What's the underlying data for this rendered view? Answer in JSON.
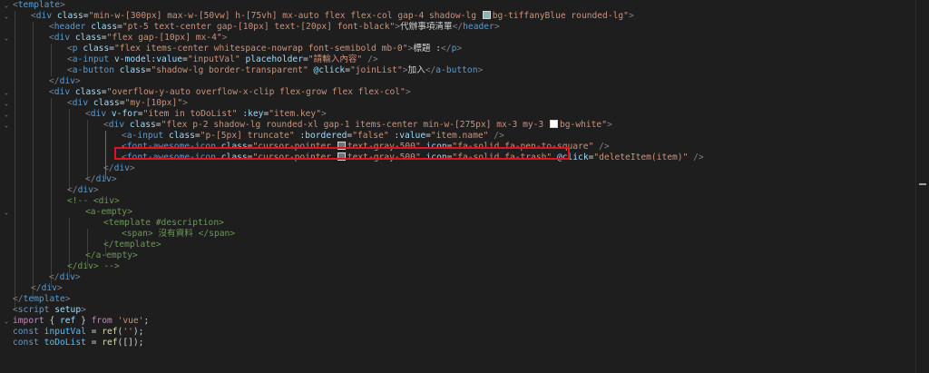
{
  "colors": {
    "background": "#1e1e1e",
    "tag": "#569cd6",
    "attribute": "#9cdcfe",
    "string": "#ce9178",
    "comment": "#6a9955",
    "keyword": "#c586c0",
    "highlight_box": "#e0141e",
    "swatch_tiffany_blue": "#7dbab5",
    "swatch_white": "#ffffff",
    "swatch_gray_500": "#6b7280"
  },
  "code": {
    "l1_tag": "template",
    "l2_tag": "div",
    "l2_attr": "class",
    "l2_val_a": "min-w-[300px] max-w-[50vw] h-[75vh] mx-auto flex flex-col gap-4 shadow-lg ",
    "l2_val_b": "bg-tiffanyBlue rounded-lg",
    "l3_tag": "header",
    "l3_attr": "class",
    "l3_val": "pt-5 text-center gap-[10px] text-[20px] font-black",
    "l3_text": "代辦事項清單",
    "l4_tag": "div",
    "l4_attr": "class",
    "l4_val": "flex gap-[10px] mx-4",
    "l5_tag": "p",
    "l5_attr": "class",
    "l5_val": "flex items-center whitespace-nowrap font-semibold mb-0",
    "l5_text": "標題 :",
    "l6_tag": "a-input",
    "l6_attr1": "v-model:value",
    "l6_val1": "inputVal",
    "l6_attr2": "placeholder",
    "l6_val2": "請輸入內容",
    "l7_tag": "a-button",
    "l7_attr1": "class",
    "l7_val1": "shadow-lg border-transparent",
    "l7_attr2": "@click",
    "l7_val2": "joinList",
    "l7_text": "加入",
    "l8_tag": "div",
    "l9_tag": "div",
    "l9_attr": "class",
    "l9_val": "overflow-y-auto overflow-x-clip flex-grow flex flex-col",
    "l10_tag": "div",
    "l10_attr": "class",
    "l10_val": "my-[10px]",
    "l11_tag": "div",
    "l11_attr1": "v-for",
    "l11_val1": "item in toDoList",
    "l11_attr2": ":key",
    "l11_val2": "item.key",
    "l12_tag": "div",
    "l12_attr": "class",
    "l12_val_a": "flex p-2 shadow-lg rounded-xl gap-1 items-center min-w-[275px] mx-3 my-3 ",
    "l12_val_b": "bg-white",
    "l13_tag": "a-input",
    "l13_attr1": "class",
    "l13_val1": "p-[5px] truncate",
    "l13_attr2": ":bordered",
    "l13_val2": "false",
    "l13_attr3": ":value",
    "l13_val3": "item.name",
    "l14_tag": "font-awesome-icon",
    "l14_attr1": "class",
    "l14_val1a": "cursor-pointer ",
    "l14_val1b": "text-gray-500",
    "l14_attr2": "icon",
    "l14_val2": "fa-solid fa-pen-to-square",
    "l15_tag": "font-awesome-icon",
    "l15_attr1": "class",
    "l15_val1a": "cursor-pointer ",
    "l15_val1b": "text-gray-500",
    "l15_attr2": "icon",
    "l15_val2": "fa-solid fa-trash",
    "l15_attr3": "@click",
    "l15_val3": "deleteItem(item)",
    "l16_tag": "div",
    "l17_tag": "div",
    "l18_tag": "div",
    "l19_comment": "<!-- <div>",
    "l20_tag": "a-empty",
    "l21_tag": "template",
    "l21_attr": "#description",
    "l22_tag": "span",
    "l22_text": " 沒有資料 ",
    "l23_tag": "template",
    "l24_tag": "a-empty",
    "l25_comment": "</div> -->",
    "l26_tag": "div",
    "l27_tag": "div",
    "l28_tag": "template",
    "l29_tag": "script",
    "l29_attr": "setup",
    "l30_kw1": "import",
    "l30_name": "ref",
    "l30_kw2": "from",
    "l30_str": "'vue'",
    "l31_kw": "const",
    "l31_var": "inputVal",
    "l31_fn": "ref",
    "l31_str": "''",
    "l32_kw": "const",
    "l32_var": "toDoList",
    "l32_fn": "ref",
    "l32_arr": "[]"
  }
}
